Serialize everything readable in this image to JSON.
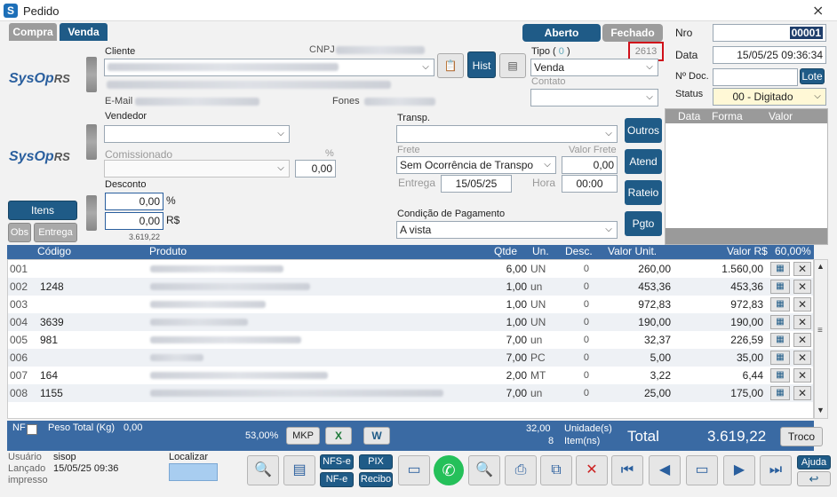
{
  "window": {
    "title": "Pedido",
    "icon_letter": "S"
  },
  "tabs": {
    "compra": "Compra",
    "venda": "Venda"
  },
  "status_tabs": {
    "aberto": "Aberto",
    "fechado": "Fechado"
  },
  "order_number": {
    "label": "Nro",
    "value": "00001"
  },
  "date": {
    "label": "Data",
    "value": "15/05/25 09:36:34"
  },
  "doc": {
    "label": "Nº Doc.",
    "value": "",
    "lote_button": "Lote"
  },
  "status": {
    "label": "Status",
    "value": "00 - Digitado"
  },
  "client": {
    "label": "Cliente",
    "cnpj_label": "CNPJ",
    "email_label": "E-Mail",
    "phones_label": "Fones",
    "hist_button": "Hist"
  },
  "type": {
    "label": "Tipo",
    "count": "0",
    "value": "Venda",
    "code": "2613",
    "contact_label": "Contato"
  },
  "vendor": {
    "label": "Vendedor",
    "commission_label": "Comissionado",
    "percent_label": "%",
    "percent_value": "0,00"
  },
  "transp": {
    "label": "Transp.",
    "freight_label": "Frete",
    "freight_value_label": "Valor Frete",
    "freight_type": "Sem Ocorrência de Transpo",
    "freight_value": "0,00",
    "delivery_label": "Entrega",
    "delivery_date": "15/05/25",
    "time_label": "Hora",
    "time_value": "00:00"
  },
  "discount": {
    "label": "Desconto",
    "percent": "0,00",
    "percent_sign": "%",
    "value": "0,00",
    "currency_sign": "R$",
    "subtotal": "3.619,22"
  },
  "payment": {
    "label": "Condição de Pagamento",
    "value": "A vista"
  },
  "side_buttons": {
    "outros": "Outros",
    "atend": "Atend",
    "rateio": "Rateio",
    "pgto": "Pgto"
  },
  "left_buttons": {
    "itens": "Itens",
    "obs": "Obs",
    "entrega": "Entrega"
  },
  "logo": {
    "main": "SysOp",
    "suffix": "RS"
  },
  "payments_table": {
    "headers": [
      "Data",
      "Forma",
      "Valor"
    ]
  },
  "items_table": {
    "headers": {
      "codigo": "Código",
      "produto": "Produto",
      "qtde": "Qtde",
      "un": "Un.",
      "desc": "Desc.",
      "valor_unit": "Valor Unit.",
      "valor_rs": "Valor R$",
      "pct": "60,00%"
    },
    "rows": [
      {
        "n": "001",
        "code": "",
        "qty": "6,00",
        "un": "UN",
        "desc": "0",
        "unit": "260,00",
        "total": "1.560,00"
      },
      {
        "n": "002",
        "code": "1248",
        "qty": "1,00",
        "un": "un",
        "desc": "0",
        "unit": "453,36",
        "total": "453,36"
      },
      {
        "n": "003",
        "code": "",
        "qty": "1,00",
        "un": "UN",
        "desc": "0",
        "unit": "972,83",
        "total": "972,83"
      },
      {
        "n": "004",
        "code": "3639",
        "qty": "1,00",
        "un": "UN",
        "desc": "0",
        "unit": "190,00",
        "total": "190,00"
      },
      {
        "n": "005",
        "code": "981",
        "qty": "7,00",
        "un": "un",
        "desc": "0",
        "unit": "32,37",
        "total": "226,59"
      },
      {
        "n": "006",
        "code": "",
        "qty": "7,00",
        "un": "PC",
        "desc": "0",
        "unit": "5,00",
        "total": "35,00"
      },
      {
        "n": "007",
        "code": "164",
        "qty": "2,00",
        "un": "MT",
        "desc": "0",
        "unit": "3,22",
        "total": "6,44"
      },
      {
        "n": "008",
        "code": "1155",
        "qty": "7,00",
        "un": "un",
        "desc": "0",
        "unit": "25,00",
        "total": "175,00"
      }
    ]
  },
  "summary": {
    "nf_label": "NF",
    "peso_label": "Peso Total (Kg)",
    "peso_value": "0,00",
    "pct": "53,00%",
    "mkp": "MKP",
    "units_value": "32,00",
    "units_label": "Unidade(s)",
    "items_value": "8",
    "items_label": "Item(ns)",
    "total_label": "Total",
    "total_value": "3.619,22",
    "troco": "Troco"
  },
  "footer": {
    "user_label": "Usuário",
    "user": "sisop",
    "launched_label": "Lançado",
    "launched": "15/05/25 09:36",
    "printed_label": "impresso",
    "search_label": "Localizar",
    "nfse": "NFS-e",
    "nfe": "NF-e",
    "pix": "PIX",
    "recibo": "Recibo",
    "ajuda": "Ajuda"
  }
}
